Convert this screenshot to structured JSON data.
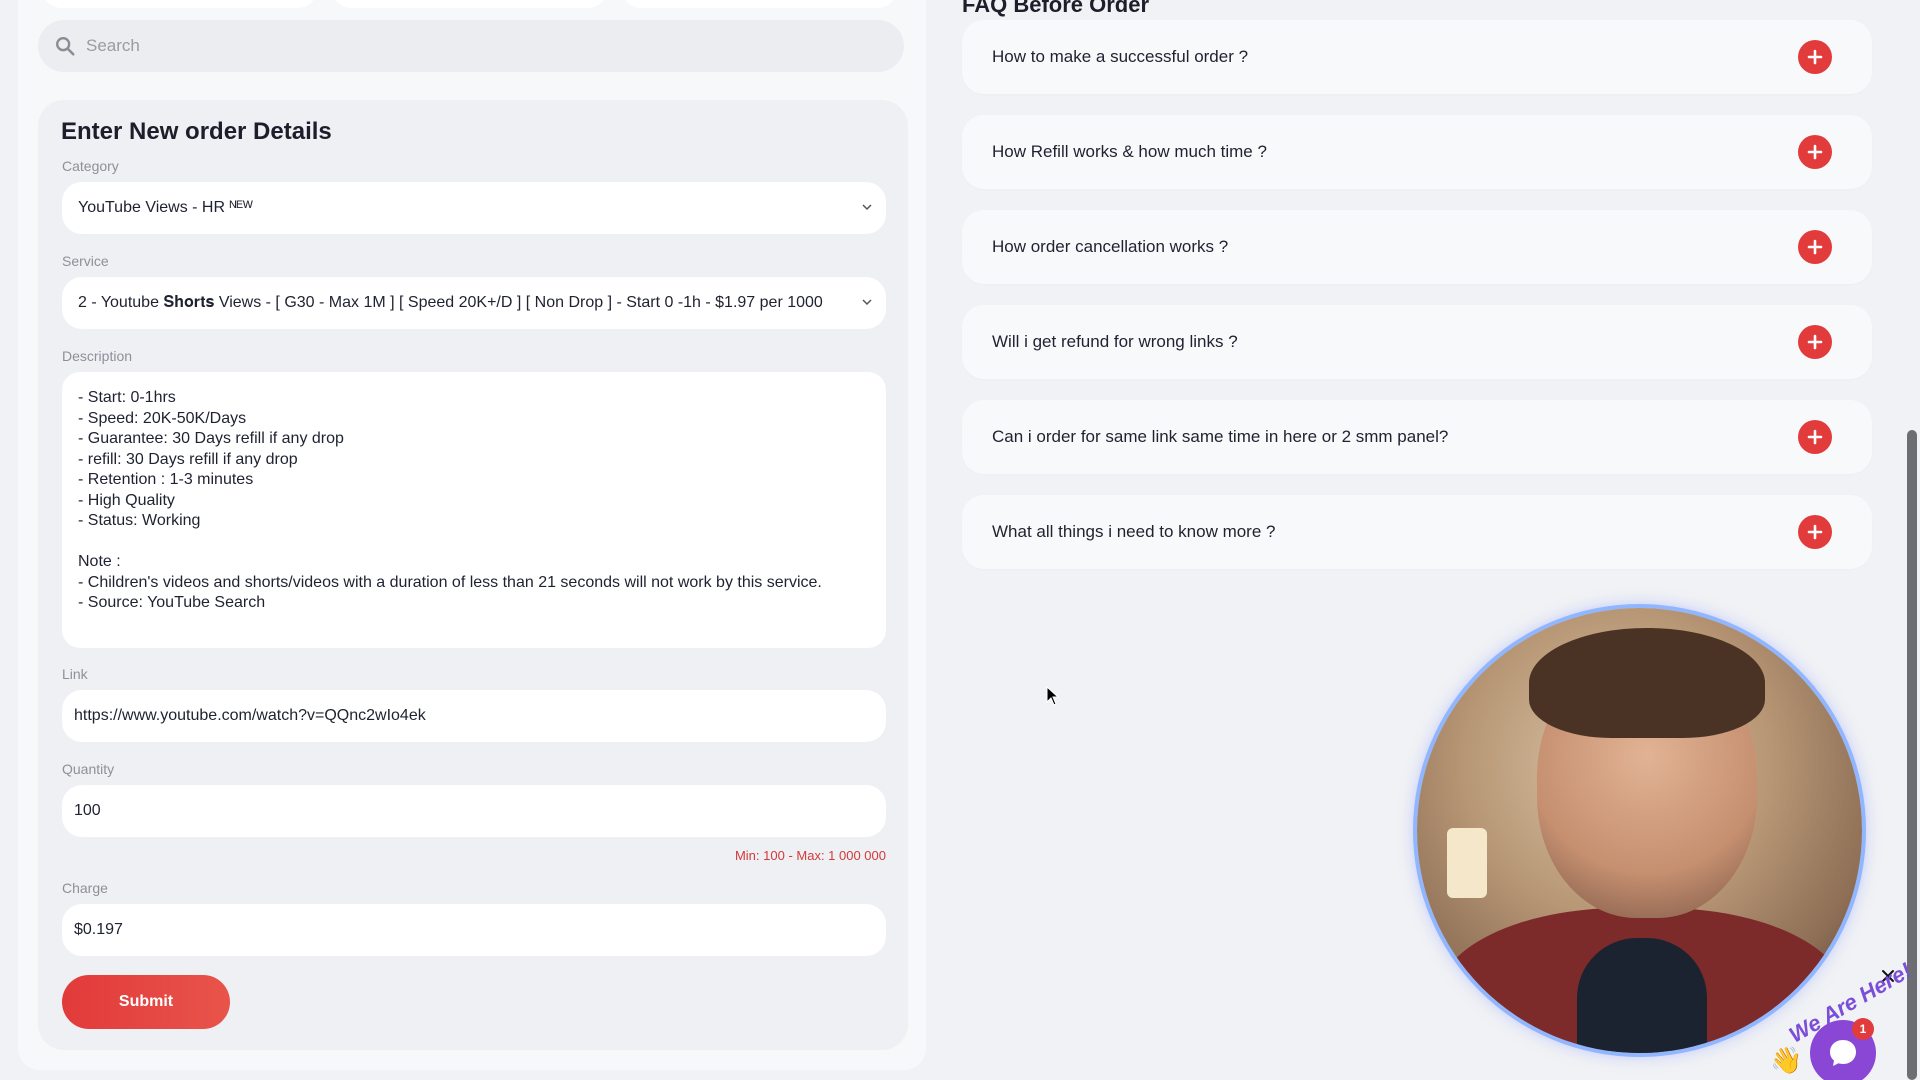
{
  "search": {
    "placeholder": "Search"
  },
  "order_form": {
    "title": "Enter New order Details",
    "category_label": "Category",
    "category_value": "YouTube Views - HR ᴺᴱᵂ",
    "service_label": "Service",
    "service_value": "2 - Youtube 𝐒𝐡𝐨𝐫𝐭𝐬 Views - [ G30 - Max 1M ] [ Speed 20K+/D ] [ Non Drop ] - Start 0 -1h - $1.97 per 1000",
    "description_label": "Description",
    "description_text": "- Start: 0-1hrs\n- Speed: 20K-50K/Days\n- Guarantee: 30 Days refill if any drop\n- refill: 30 Days refill if any drop\n- Retention : 1-3 minutes\n- High Quality\n- Status: Working\n\nNote :\n- Children's videos and shorts/videos with a duration of less than 21 seconds will not work by this service.\n- Source: YouTube Search",
    "link_label": "Link",
    "link_value": "https://www.youtube.com/watch?v=QQnc2wIo4ek",
    "quantity_label": "Quantity",
    "quantity_value": "100",
    "quantity_hint": "Min: 100 - Max: 1 000 000",
    "charge_label": "Charge",
    "charge_value": "$0.197",
    "submit_label": "Submit"
  },
  "faq": {
    "heading": "FAQ Before Order",
    "items": [
      {
        "question": "How to make a successful order ?"
      },
      {
        "question": "How Refill works & how much time ?"
      },
      {
        "question": "How order cancellation works ?"
      },
      {
        "question": "Will i get refund for wrong links ?"
      },
      {
        "question": "Can i order for same link same time in here or 2 smm panel?"
      },
      {
        "question": "What all things i need to know more ?"
      }
    ]
  },
  "chat_widget": {
    "badge_text": "We Are Here!",
    "notification_count": "1"
  },
  "colors": {
    "accent_red": "#e23b3b",
    "chat_purple": "#8a47d6",
    "page_bg": "#f1f2f5"
  }
}
